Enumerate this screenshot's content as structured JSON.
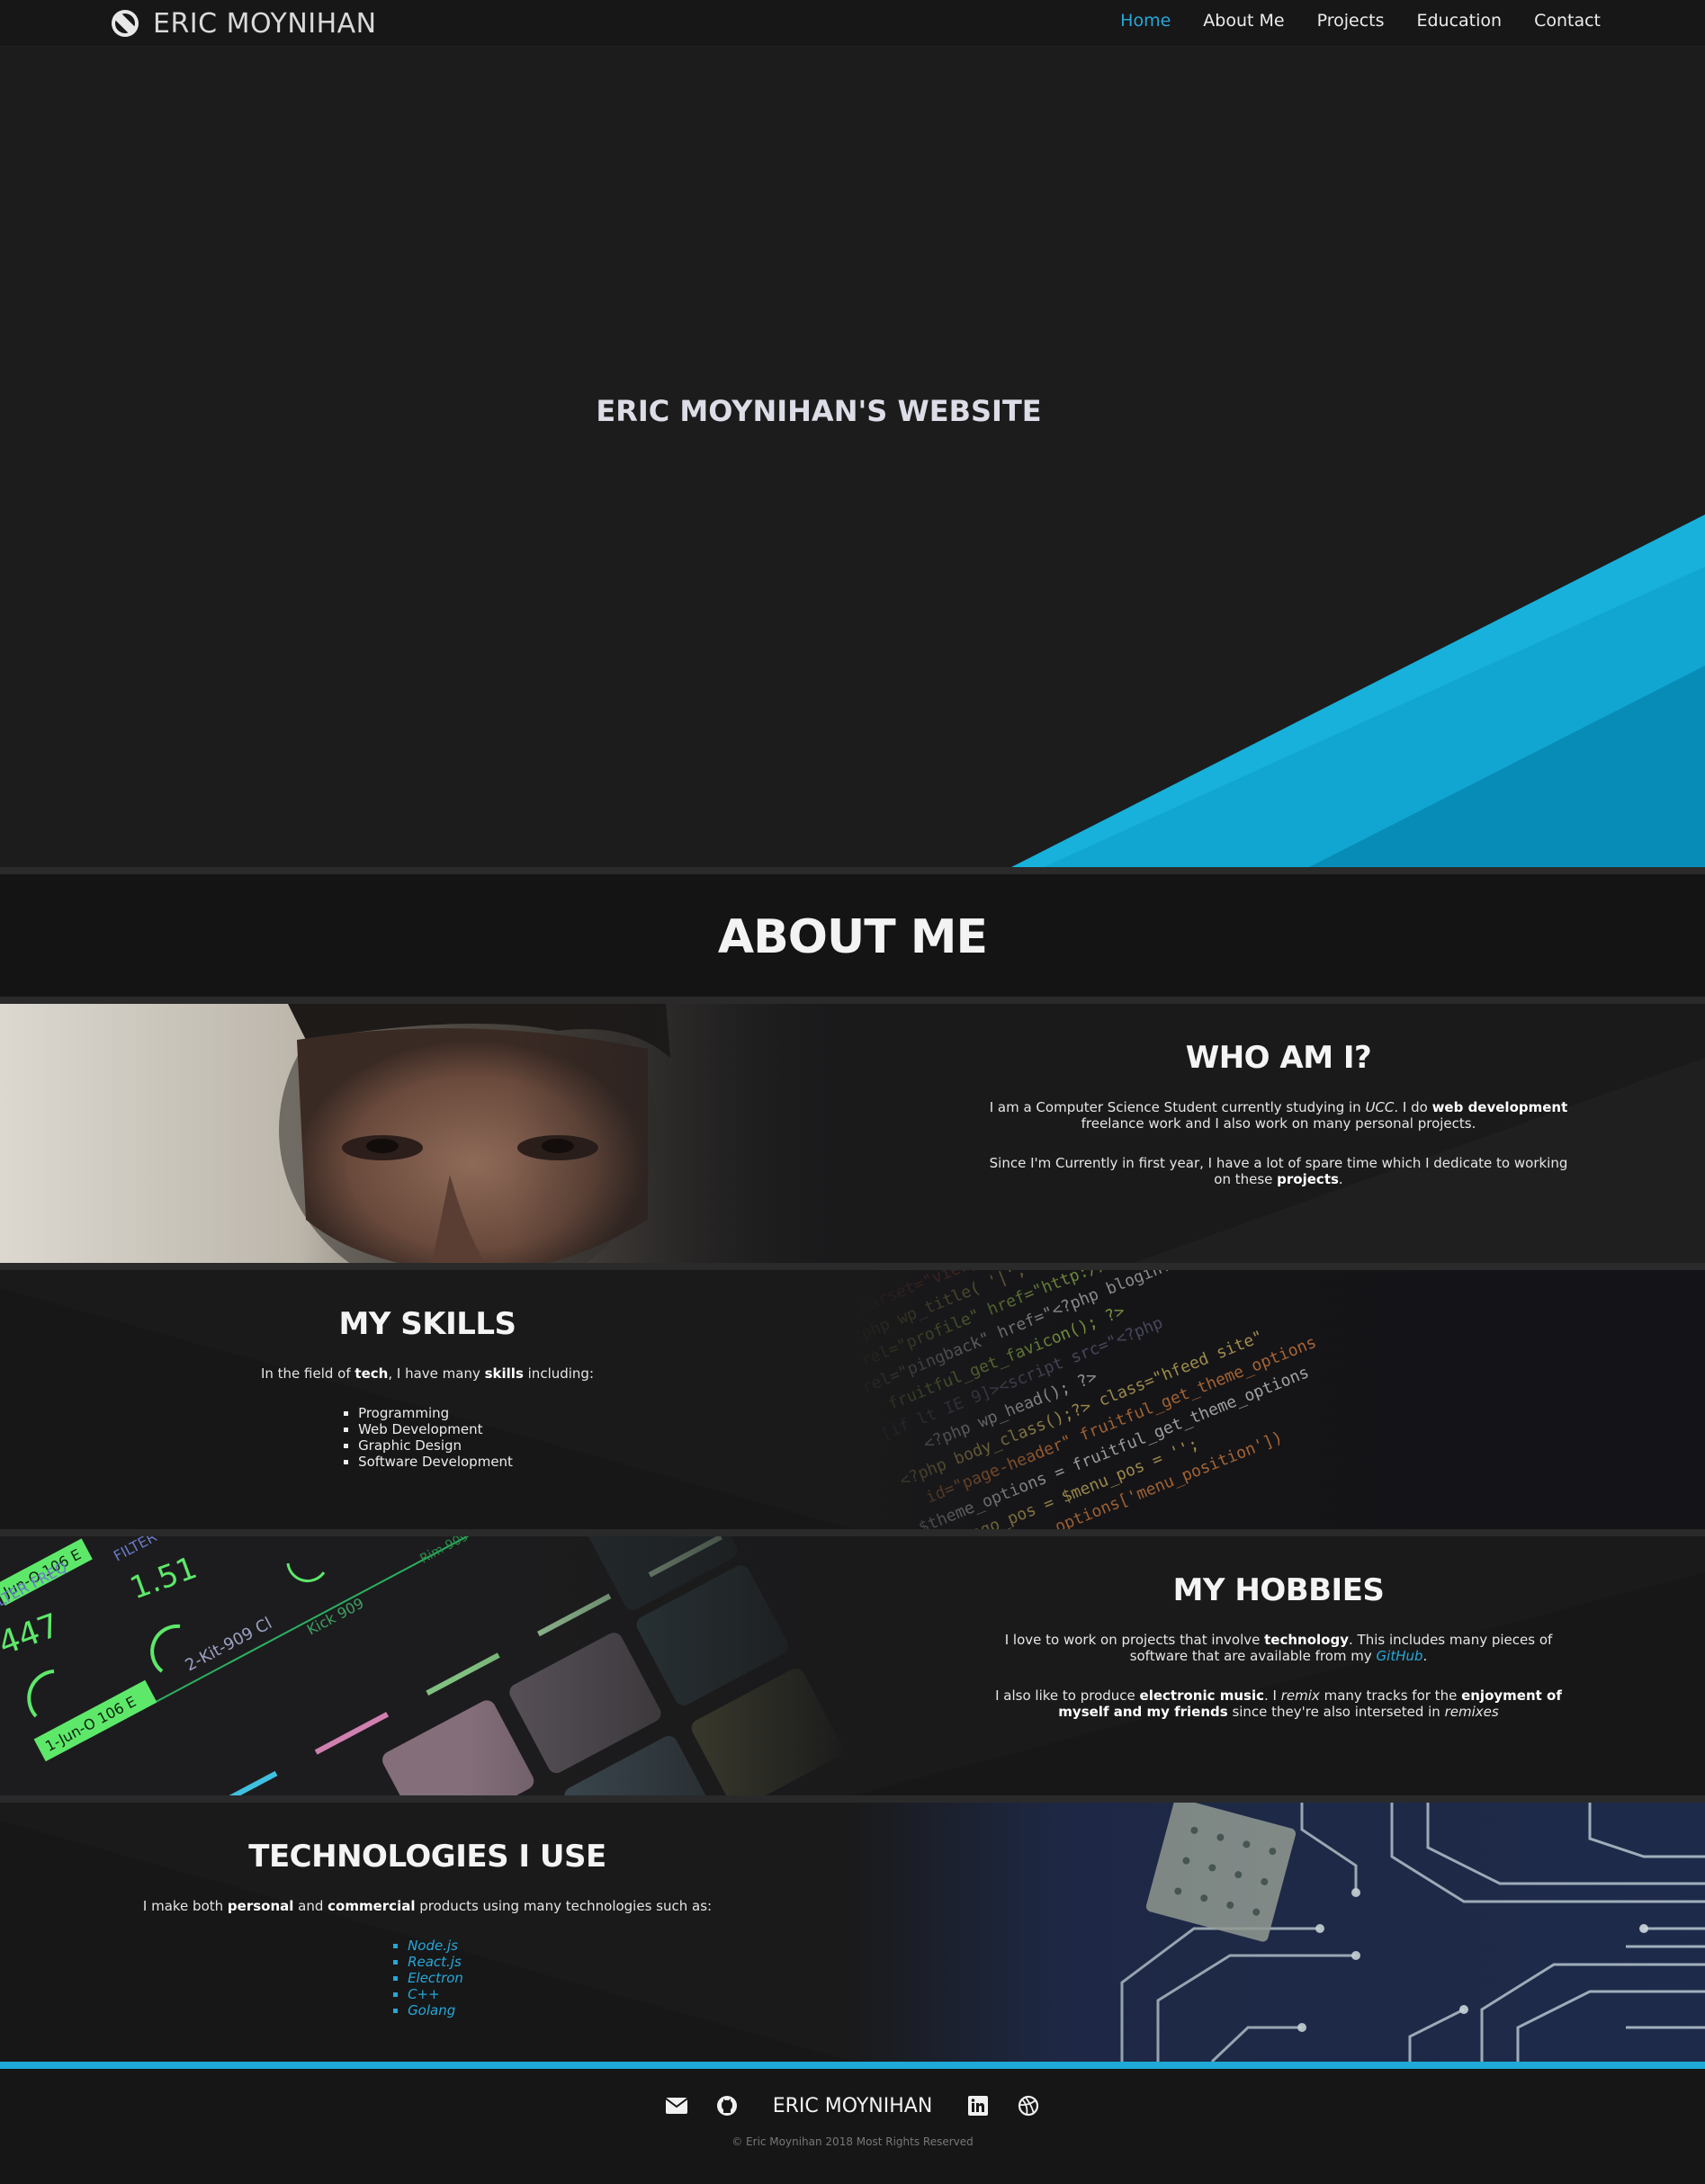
{
  "nav": {
    "brand": "ERIC MOYNIHAN",
    "links": [
      {
        "label": "Home",
        "active": true
      },
      {
        "label": "About Me"
      },
      {
        "label": "Projects"
      },
      {
        "label": "Education"
      },
      {
        "label": "Contact"
      }
    ]
  },
  "hero": {
    "title": "ERIC MOYNIHAN'S WEBSITE"
  },
  "about": {
    "title": "ABOUT ME",
    "who": {
      "title": "WHO AM I?",
      "p1_a": "I am a Computer Science Student currently studying in ",
      "p1_ucc": "UCC",
      "p1_b": ". I do ",
      "p1_bold": "web development",
      "p1_c": " freelance work and I also work on many personal projects.",
      "p2_a": "Since I'm Currently in first year, I have a lot of spare time which I dedicate to working on these ",
      "p2_bold": "projects",
      "p2_b": "."
    },
    "skills": {
      "title": "MY SKILLS",
      "intro_a": "In the field of ",
      "intro_b1": "tech",
      "intro_c": ", I have many ",
      "intro_b2": "skills",
      "intro_d": " including:",
      "items": [
        "Programming",
        "Web Development",
        "Graphic Design",
        "Software Development"
      ]
    },
    "hobbies": {
      "title": "MY HOBBIES",
      "p1_a": "I love to work on projects that involve ",
      "p1_bold": "technology",
      "p1_b": ". This includes many pieces of software that are available from my ",
      "p1_link": "GitHub",
      "p1_c": ".",
      "p2_a": "I also like to produce ",
      "p2_bold1": "electronic music",
      "p2_b": ". I ",
      "p2_i1": "remix",
      "p2_c": " many tracks for the ",
      "p2_bold2": "enjoyment of myself and my friends",
      "p2_d": " since they're also interseted in ",
      "p2_i2": "remixes"
    },
    "tech": {
      "title": "TECHNOLOGIES I USE",
      "intro_a": "I make both ",
      "intro_b1": "personal",
      "intro_c": " and ",
      "intro_b2": "commercial",
      "intro_d": " products using many technologies such as:",
      "items": [
        "Node.js",
        "React.js",
        "Electron",
        "C++",
        "Golang"
      ]
    }
  },
  "footer": {
    "name": "ERIC MOYNIHAN",
    "copyright": "© Eric Moynihan 2018 Most Rights Reserved",
    "icons": [
      "envelope-icon",
      "github-icon",
      "linkedin-icon",
      "dribbble-icon"
    ]
  },
  "colors": {
    "accent": "#1fa9d6",
    "background": "#1c1c1d",
    "nav": "#171718"
  }
}
